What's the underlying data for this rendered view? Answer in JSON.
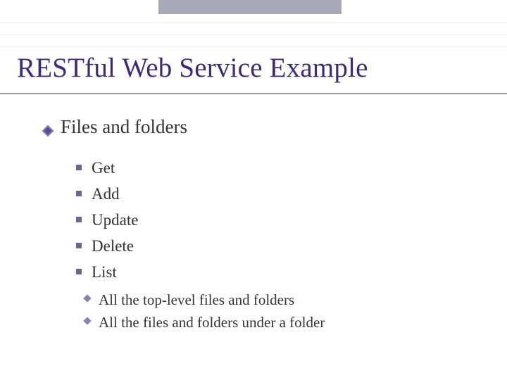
{
  "title": "RESTful Web Service Example",
  "section": "Files and folders",
  "subitems": [
    "Get",
    "Add",
    "Update",
    "Delete",
    "List"
  ],
  "subsubitems": [
    "All the top-level files and folders",
    "All the files and folders under a folder"
  ]
}
